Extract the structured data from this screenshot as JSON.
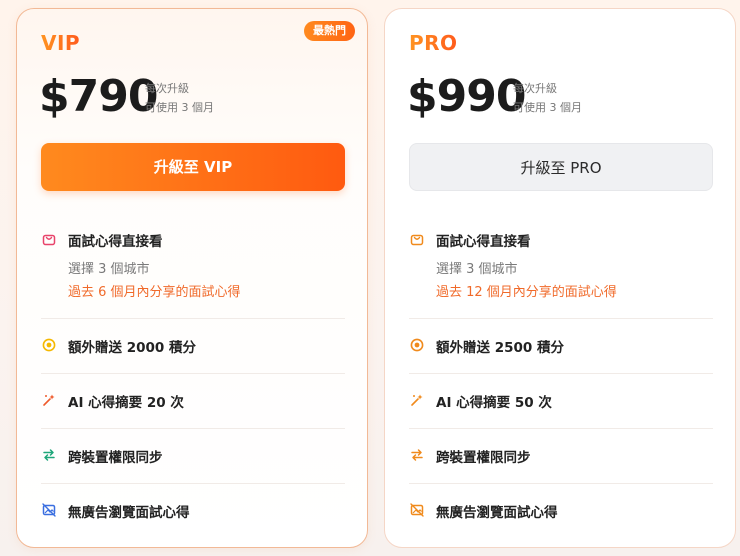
{
  "plans": [
    {
      "name": "VIP",
      "badge": "最熱門",
      "price": "$790",
      "price_line1": "每次升級",
      "price_line2": "可使用 3 個月",
      "button_label": "升級至 VIP",
      "features": {
        "f1_title": "面試心得直接看",
        "f1_sub1": "選擇 3 個城市",
        "f1_sub2": "過去 6 個月內分享的面試心得",
        "f2_title": "額外贈送 2000 積分",
        "f3_title": "AI 心得摘要 20 次",
        "f4_title": "跨裝置權限同步",
        "f5_title": "無廣告瀏覽面試心得"
      }
    },
    {
      "name": "PRO",
      "price": "$990",
      "price_line1": "每次升級",
      "price_line2": "可使用 3 個月",
      "button_label": "升級至 PRO",
      "features": {
        "f1_title": "面試心得直接看",
        "f1_sub1": "選擇 3 個城市",
        "f1_sub2": "過去 12 個月內分享的面試心得",
        "f2_title": "額外贈送 2500 積分",
        "f3_title": "AI 心得摘要 50 次",
        "f4_title": "跨裝置權限同步",
        "f5_title": "無廣告瀏覽面試心得"
      }
    }
  ],
  "icons": {
    "f1": "shopping-bag-icon",
    "f2": "coin-icon",
    "f3": "sparkle-icon",
    "f4": "sync-arrows-icon",
    "f5": "no-ads-image-icon"
  },
  "colors": {
    "accent": "#ff6a1a",
    "accent_light": "#ff9421",
    "vip_icon_pink": "#e8436a",
    "vip_icon_yellow": "#f5b800",
    "vip_icon_green": "#1fa67a",
    "vip_icon_blue": "#3a6fe0",
    "pro_icon": "#f08a1c",
    "highlight_text": "#f06a2a"
  }
}
